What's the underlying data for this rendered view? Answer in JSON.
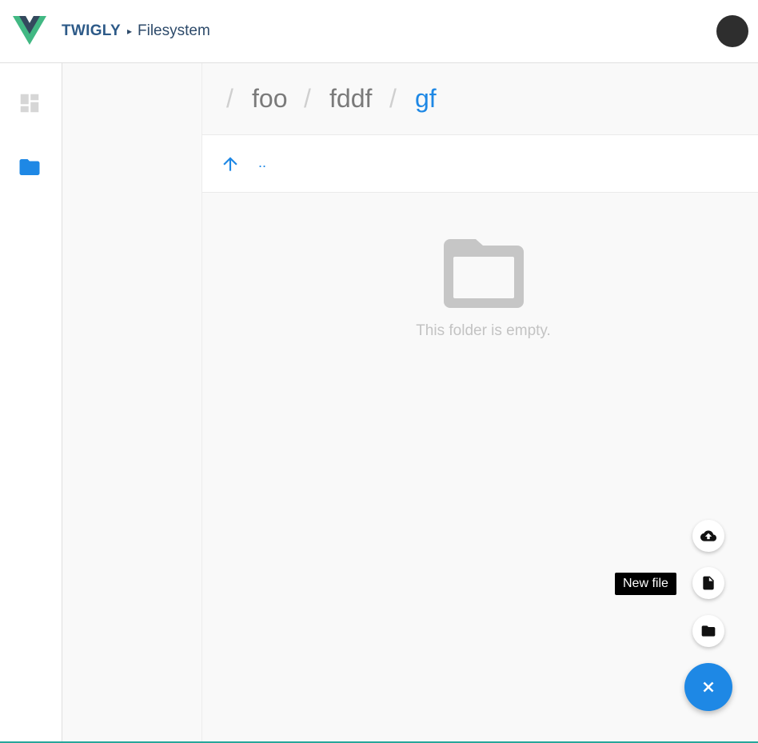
{
  "header": {
    "brand": "TWIGLY",
    "separator": "▸",
    "section": "Filesystem",
    "logo_icon": "vue-logo-icon",
    "avatar_icon": "user-avatar"
  },
  "rail": {
    "items": [
      {
        "icon": "dashboard-icon",
        "active": false
      },
      {
        "icon": "folder-icon",
        "active": true
      }
    ]
  },
  "breadcrumb": {
    "separator": "/",
    "items": [
      "foo",
      "fddf",
      "gf"
    ],
    "current": "gf"
  },
  "listing": {
    "up_label": "..",
    "up_icon": "arrow-up-icon",
    "empty_icon": "folder-icon",
    "empty_text": "This folder is empty."
  },
  "speed_dial": {
    "actions": [
      {
        "icon": "cloud-upload-icon"
      },
      {
        "icon": "new-file-icon"
      },
      {
        "icon": "new-folder-icon"
      }
    ],
    "tooltip": "New file",
    "main_icon": "close-icon"
  },
  "colors": {
    "accent": "#1e88e5",
    "brand_text": "#2d5a88",
    "logo_green": "#41b883",
    "logo_dark": "#34495e",
    "bottom_line": "#26a69a"
  }
}
